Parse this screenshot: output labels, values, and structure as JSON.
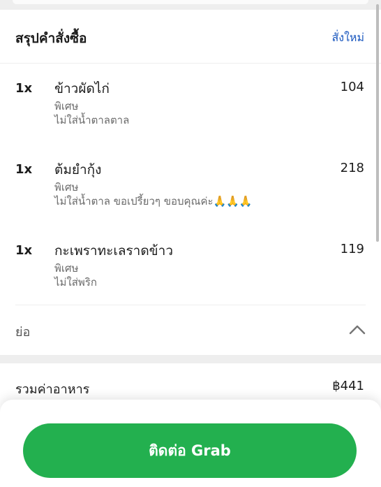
{
  "summary": {
    "title": "สรุปคำสั่งซื้อ",
    "reorder_label": "สั่งใหม่"
  },
  "items": [
    {
      "qty": "1x",
      "name": "ข้าวผัดไก่",
      "price": "104",
      "note_label": "พิเศษ",
      "note_text": "ไม่ใส่น้ำตาลตาล"
    },
    {
      "qty": "1x",
      "name": "ต้มยำกุ้ง",
      "price": "218",
      "note_label": "พิเศษ",
      "note_text": "ไม่ใส่น้ำตาล ขอเปรี้ยวๆ ขอบคุณค่ะ",
      "note_emoji": "🙏🙏🙏"
    },
    {
      "qty": "1x",
      "name": "กะเพราทะเลราดข้าว",
      "price": "119",
      "note_label": "พิเศษ",
      "note_text": "ไม่ใส่พริก"
    }
  ],
  "collapse": {
    "label": "ย่อ",
    "icon": "chevron-up-icon"
  },
  "total": {
    "label": "รวมค่าอาหาร",
    "value": "฿441"
  },
  "action": {
    "contact_label": "ติดต่อ Grab"
  },
  "colors": {
    "accent_green": "#23b04f",
    "link_blue": "#1b58bf"
  }
}
